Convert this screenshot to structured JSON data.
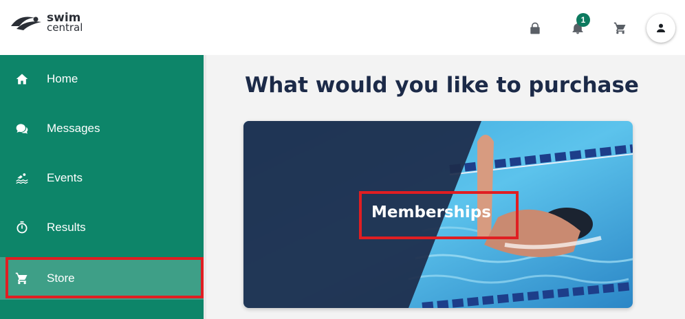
{
  "app": {
    "logo_line1": "swim",
    "logo_line2": "central"
  },
  "topbar": {
    "icons": [
      "lock-icon",
      "bell-icon",
      "cart-icon",
      "profile-icon"
    ],
    "notification_count": "1"
  },
  "sidebar": {
    "items": [
      {
        "label": "Home",
        "icon": "home-icon"
      },
      {
        "label": "Messages",
        "icon": "chat-bubbles-icon"
      },
      {
        "label": "Events",
        "icon": "swimmer-icon"
      },
      {
        "label": "Results",
        "icon": "stopwatch-icon"
      },
      {
        "label": "Store",
        "icon": "store-cart-icon",
        "active": true
      }
    ]
  },
  "main": {
    "heading": "What would you like to purchase",
    "cards": [
      {
        "title": "Memberships"
      }
    ]
  },
  "colors": {
    "sidebar": "#0d8569",
    "sidebar_active": "#3e9f87",
    "heading": "#1c2a48",
    "highlight": "#e01e22",
    "badge": "#0d7a5f"
  }
}
